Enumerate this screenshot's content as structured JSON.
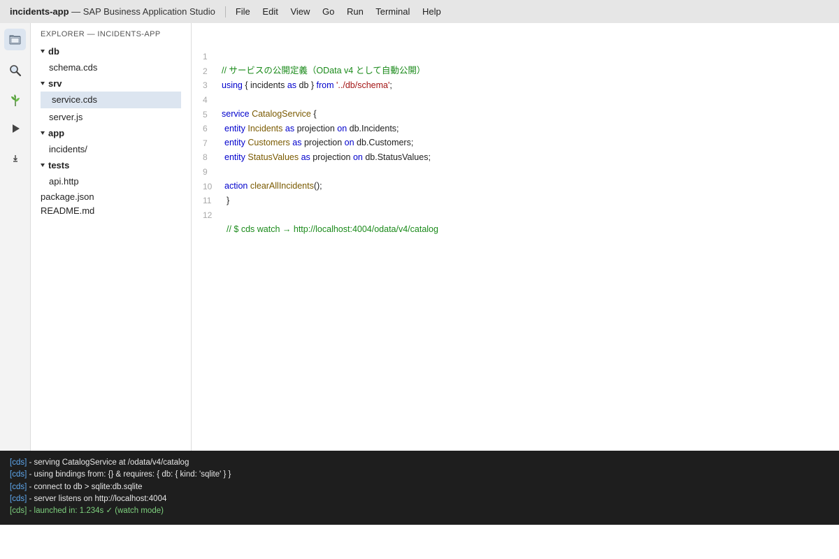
{
  "titlebar": {
    "app_name": "incidents-app",
    "app_suffix": " — SAP Business Application Studio",
    "menu": [
      "File",
      "Edit",
      "View",
      "Go",
      "Run",
      "Terminal",
      "Help"
    ]
  },
  "activity_bar": {
    "items": [
      "explorer-icon",
      "search-icon",
      "source-control-icon",
      "run-icon",
      "download-icon"
    ]
  },
  "explorer": {
    "header": "EXPLORER — INCIDENTS-APP",
    "tree": [
      {
        "label": "db",
        "kind": "folder"
      },
      {
        "label": "schema.cds",
        "kind": "file",
        "indent": 1
      },
      {
        "label": "srv",
        "kind": "folder"
      },
      {
        "label": "service.cds",
        "kind": "file",
        "indent": 1,
        "selected": true
      },
      {
        "label": "server.js",
        "kind": "file",
        "indent": 1
      },
      {
        "label": "app",
        "kind": "folder"
      },
      {
        "label": "incidents/",
        "kind": "file",
        "indent": 1
      },
      {
        "label": "tests",
        "kind": "folder"
      },
      {
        "label": "api.http",
        "kind": "file",
        "indent": 1
      },
      {
        "label": "package.json",
        "kind": "file",
        "indent": 0
      },
      {
        "label": "README.md",
        "kind": "file",
        "indent": 0
      }
    ]
  },
  "editor": {
    "line_numbers": [
      "1",
      "2",
      "3",
      "4",
      "5",
      "6",
      "7",
      "8",
      "9",
      "10",
      "11",
      "12"
    ],
    "lines": {
      "l1": "// サービスの公開定義（OData v4 として自動公開）",
      "l2": {
        "a": "using",
        "b": " { incidents ",
        "c": "as",
        "d": " db } ",
        "e": "from",
        "f": " ",
        "g": "'../db/schema'",
        "h": ";"
      },
      "l4": {
        "a": "service",
        "b": " ",
        "c": "CatalogService",
        "d": " {"
      },
      "l5": {
        "a": "entity",
        "b": " ",
        "c": "Incidents",
        "d": " ",
        "e": "as",
        "f": " projection ",
        "g": "on",
        "h": " db.Incidents;"
      },
      "l6": {
        "a": "entity",
        "b": " ",
        "c": "Customers",
        "d": " ",
        "e": "as",
        "f": " projection ",
        "g": "on",
        "h": " db.Customers;"
      },
      "l7": {
        "a": "entity",
        "b": " ",
        "c": "StatusValues",
        "d": " ",
        "e": "as",
        "f": " projection ",
        "g": "on",
        "h": " db.StatusValues;"
      },
      "l9": {
        "a": "action",
        "b": " ",
        "c": "clearAllIncidents",
        "d": "();"
      },
      "l10": "}",
      "l12": "// $ cds watch → http://localhost:4004/odata/v4/catalog"
    }
  },
  "terminal": {
    "tag": "[cds]",
    "lines": [
      " - serving CatalogService at /odata/v4/catalog",
      " - using bindings from: {} & requires: { db: { kind: 'sqlite' } }",
      " - connect to db > sqlite:db.sqlite",
      " - server listens on http://localhost:4004",
      " - launched in: 1.234s ✓ (watch mode)"
    ]
  }
}
